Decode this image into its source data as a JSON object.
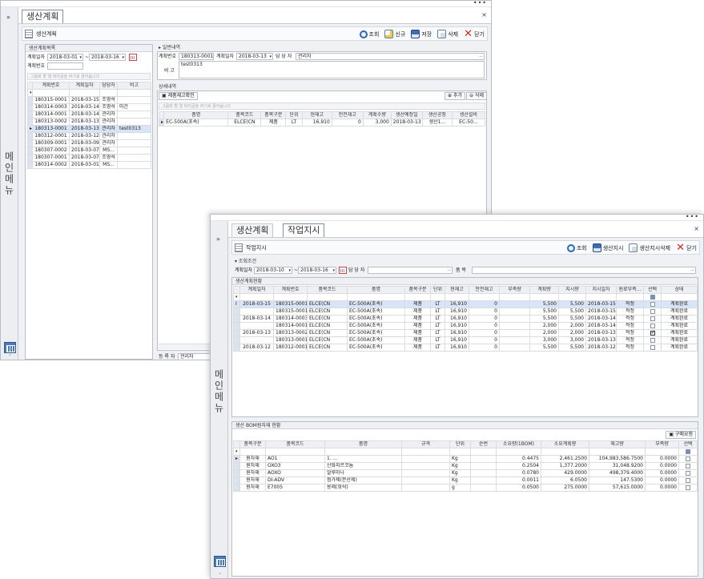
{
  "shell": {
    "menu_label": "메인메뉴",
    "more": "•••",
    "collapse": "»"
  },
  "back_window": {
    "tabs": [
      {
        "label": "생산계획"
      }
    ],
    "toolbar": {
      "title": "생산계획",
      "buttons": [
        "조회",
        "신규",
        "저장",
        "삭제",
        "닫기"
      ]
    },
    "left": {
      "header": "생산계획목록",
      "date_label": "계획일자",
      "date_from": "2018-03-01",
      "date_sep": "~",
      "date_to": "2018-03-16",
      "no_label": "계획번호",
      "group_hint": "그룹화 할 열 머리글을 여기로 끌어옵니다",
      "columns": [
        "계획번호",
        "계획일자",
        "담당자",
        "비고"
      ],
      "rows": [
        [
          "180315-0001",
          "2018-03-15",
          "조영석",
          ""
        ],
        [
          "180314-0003",
          "2018-03-14",
          "조영석",
          "미간"
        ],
        [
          "180314-0001",
          "2018-03-14",
          "관리자",
          ""
        ],
        [
          "180313-0002",
          "2018-03-13",
          "관리자",
          ""
        ],
        [
          "180313-0001",
          "2018-03-13",
          "관리자",
          "test0313"
        ],
        [
          "180312-0001",
          "2018-03-12",
          "관리자",
          ""
        ],
        [
          "180309-0001",
          "2018-03-09",
          "관리자",
          ""
        ],
        [
          "180307-0002",
          "2018-03-07",
          "MS...",
          ""
        ],
        [
          "180307-0001",
          "2018-03-07",
          "조영석",
          ""
        ],
        [
          "180314-0002",
          "2018-03-01",
          "MS...",
          ""
        ]
      ]
    },
    "general": {
      "header": "일반내역",
      "no_label": "계획번호",
      "no": "180313-0001",
      "date_label": "계획일자",
      "date": "2018-03-13",
      "manager_label": "담 당 자",
      "manager": "관리자",
      "note_label": "비 고",
      "note": "test0313"
    },
    "detail": {
      "header": "상세내역",
      "stock_btn": "제품재고확인",
      "add_btn": "추가",
      "del_btn": "삭제",
      "group_hint": "그룹화 할 열 머리글을 여기로 끌어옵니다",
      "columns": [
        "품명",
        "품목코드",
        "품목구분",
        "단위",
        "현재고",
        "안전재고",
        "계획수량",
        "생산예정일",
        "생산공정",
        "생산설비"
      ],
      "row": [
        "EC-500A(초속)",
        "ELCE(CN",
        "제품",
        "LT",
        "16,910",
        "0",
        "3,000",
        "2018-03-13",
        "생산1...",
        "EC-50..."
      ]
    },
    "footer": {
      "label": "등 록 자",
      "value": "관리자"
    }
  },
  "front_window": {
    "tabs": [
      {
        "label": "생산계획"
      },
      {
        "label": "작업지시"
      }
    ],
    "toolbar": {
      "title": "작업지시",
      "buttons": [
        "조회",
        "생산지시",
        "생산지시삭제",
        "닫기"
      ]
    },
    "search": {
      "header": "조회조건",
      "date_label": "계획일자",
      "date_from": "2018-03-10",
      "date_sep": "~",
      "date_to": "2018-03-16",
      "manager_label": "담 당 자",
      "item_label": "품 목"
    },
    "plan": {
      "header": "생산계획현황",
      "columns": [
        "계획일자",
        "계획번호",
        "품목코드",
        "품명",
        "품목구분",
        "단위",
        "현재고",
        "안전재고",
        "부족량",
        "계획량",
        "지시량",
        "지시일자",
        "원료부족...",
        "선택",
        "상태"
      ],
      "rows": [
        [
          "2018-03-15",
          "180315-0001",
          "ELCE(CN",
          "EC-500A(초속)",
          "제품",
          "LT",
          "16,910",
          "0",
          "",
          "5,500",
          "5,500",
          "2018-03-15",
          "적정",
          false,
          "계획완료"
        ],
        [
          "",
          "180315-0001",
          "ELCE(CN",
          "EC-500A(초속)",
          "제품",
          "LT",
          "16,910",
          "0",
          "",
          "5,500",
          "5,500",
          "2018-03-15",
          "적정",
          false,
          "계획완료"
        ],
        [
          "2018-03-14",
          "180314-0003",
          "ELCE(CN",
          "EC-500A(초속)",
          "제품",
          "LT",
          "16,910",
          "0",
          "",
          "5,500",
          "5,500",
          "2018-03-14",
          "적정",
          false,
          "계획완료"
        ],
        [
          "",
          "180314-0001",
          "ELCE(CN",
          "EC-500A(초속)",
          "제품",
          "LT",
          "16,910",
          "0",
          "",
          "2,000",
          "2,000",
          "2018-03-14",
          "적정",
          false,
          "계획완료"
        ],
        [
          "2018-03-13",
          "180313-0002",
          "ELCE(CN",
          "EC-500A(초속)",
          "제품",
          "LT",
          "16,910",
          "0",
          "",
          "2,000",
          "2,000",
          "2018-03-13",
          "적정",
          true,
          "계획완료"
        ],
        [
          "",
          "180313-0001",
          "ELCE(CN",
          "EC-500A(초속)",
          "제품",
          "LT",
          "16,910",
          "0",
          "",
          "3,000",
          "3,000",
          "2018-03-13",
          "적정",
          false,
          "계획완료"
        ],
        [
          "2018-03-12",
          "180312-0001",
          "ELCE(CN",
          "EC-500A(초속)",
          "제품",
          "LT",
          "16,910",
          "0",
          "",
          "5,500",
          "5,500",
          "2018-03-12",
          "적정",
          false,
          "계획완료"
        ]
      ]
    },
    "bom": {
      "header": "생산 BOM원자재 현황",
      "request_btn": "구매요청",
      "columns": [
        "품목구분",
        "품목코드",
        "품명",
        "규격",
        "단위",
        "순번",
        "소요량(1BOM)",
        "소요계획량",
        "재고량",
        "부족량",
        "선택"
      ],
      "rows": [
        [
          "원자재",
          "AO1",
          "1. ...",
          "",
          "Kg",
          "",
          "0.4475",
          "2,461.2500",
          "104,983,586.7500",
          "0.0000",
          false
        ],
        [
          "원자재",
          "OXO3",
          "산화지르코늄",
          "",
          "Kg",
          "",
          "0.2504",
          "1,377.2000",
          "31,048.9200",
          "0.0000",
          false
        ],
        [
          "원자재",
          "AOXO",
          "알루미나",
          "",
          "Kg",
          "",
          "0.0780",
          "429.0000",
          "498,379.4000",
          "0.0000",
          false
        ],
        [
          "원자재",
          "DI-ADV",
          "첨가제(분산제)",
          "",
          "Kg",
          "",
          "0.0011",
          "6.0500",
          "147.5300",
          "0.0000",
          false
        ],
        [
          "원자재",
          "E7005",
          "용제(희석)",
          "",
          "g",
          "",
          "0.0500",
          "275.0000",
          "57,615.0000",
          "0.0000",
          false
        ]
      ]
    }
  }
}
